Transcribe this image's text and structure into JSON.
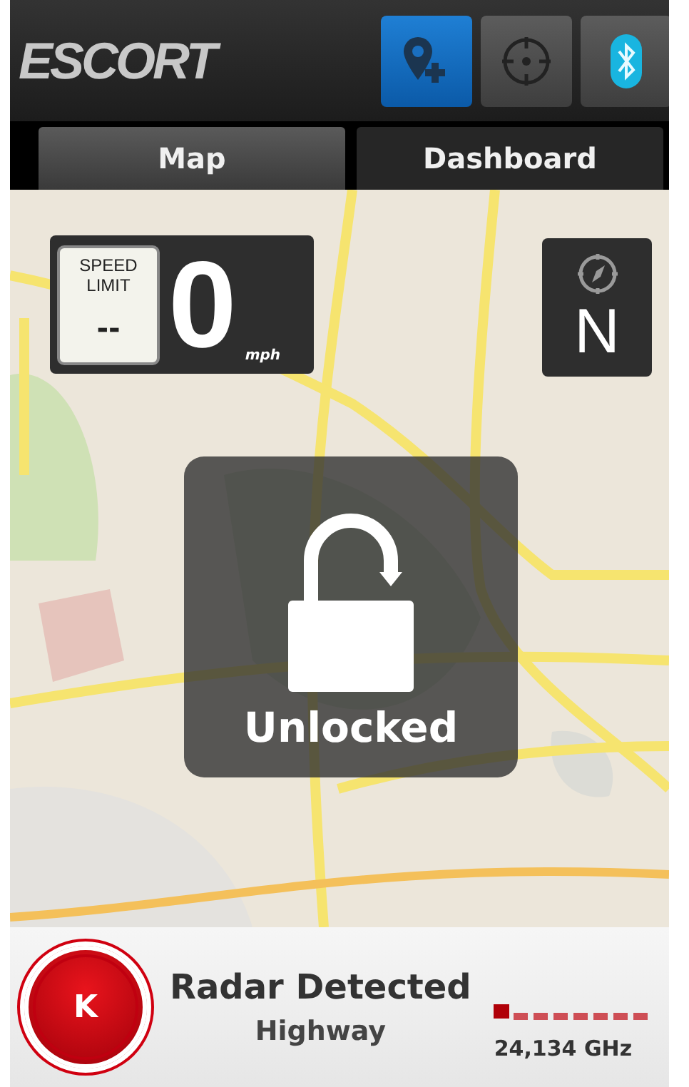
{
  "header": {
    "logo": "ESCORT",
    "buttons": [
      {
        "kind": "add-location",
        "active": true
      },
      {
        "kind": "locate",
        "active": false
      },
      {
        "kind": "bluetooth",
        "active": false
      }
    ]
  },
  "tabs": [
    {
      "label": "Map",
      "selected": true
    },
    {
      "label": "Dashboard",
      "selected": false
    }
  ],
  "map": {
    "kind": "picture",
    "speed": {
      "limit_label": "SPEED LIMIT",
      "limit_value": "--",
      "value": "0",
      "unit": "mph"
    },
    "compass": {
      "heading": "N"
    },
    "lock": {
      "locked": false,
      "label": "Unlocked"
    }
  },
  "alert": {
    "band": "K",
    "title": "Radar Detected",
    "mode": "Highway",
    "level": 0.125,
    "frequency": "24,134 GHz"
  }
}
